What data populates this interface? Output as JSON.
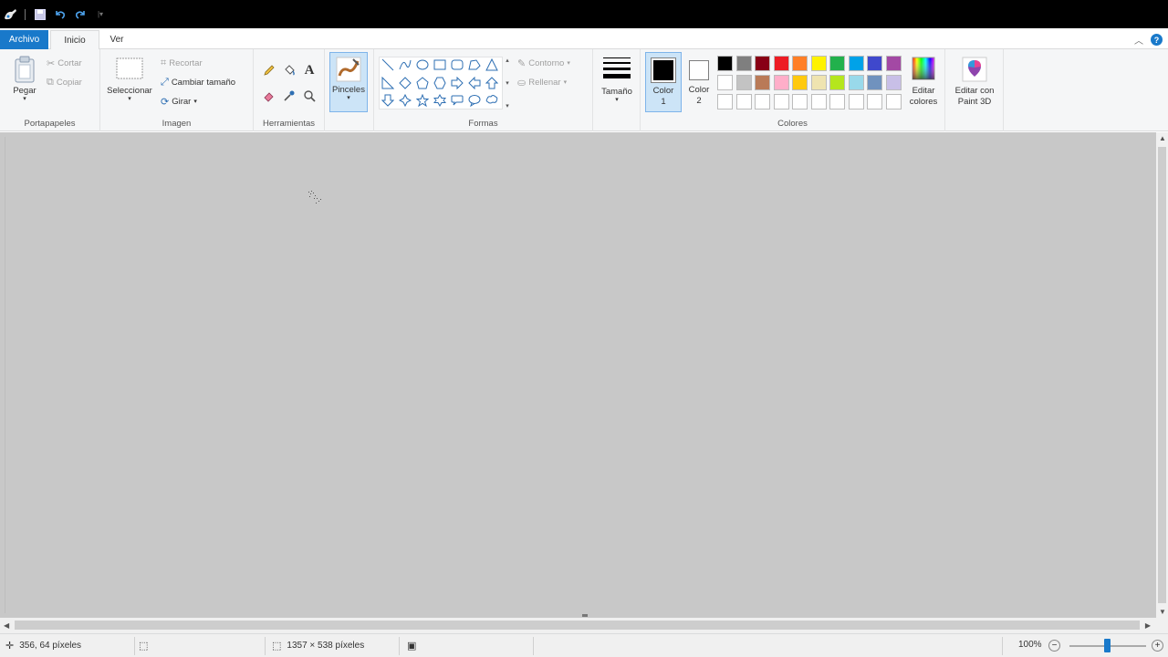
{
  "quick_access": {
    "icons": [
      "paint-app-icon",
      "save-icon",
      "undo-icon",
      "redo-icon",
      "customize-arrow-icon"
    ]
  },
  "tabs": {
    "file": "Archivo",
    "home": "Inicio",
    "view": "Ver"
  },
  "ribbon": {
    "clipboard": {
      "label": "Portapapeles",
      "paste": "Pegar",
      "cut": "Cortar",
      "copy": "Copiar"
    },
    "image": {
      "label": "Imagen",
      "select": "Seleccionar",
      "crop": "Recortar",
      "resize": "Cambiar tamaño",
      "rotate": "Girar"
    },
    "tools": {
      "label": "Herramientas"
    },
    "brushes": {
      "label": "Pinceles"
    },
    "shapes": {
      "label": "Formas",
      "outline": "Contorno",
      "fill": "Rellenar"
    },
    "size": {
      "label": "Tamaño"
    },
    "colors": {
      "label": "Colores",
      "color1_line1": "Color",
      "color1_line2": "1",
      "color2_line1": "Color",
      "color2_line2": "2",
      "edit_colors_line1": "Editar",
      "edit_colors_line2": "colores",
      "color1_value": "#000000",
      "color2_value": "#ffffff",
      "palette_row1": [
        "#000000",
        "#7f7f7f",
        "#880015",
        "#ed1c24",
        "#ff7f27",
        "#fff200",
        "#22b14c",
        "#00a2e8",
        "#3f48cc",
        "#a349a4"
      ],
      "palette_row2": [
        "#ffffff",
        "#c3c3c3",
        "#b97a57",
        "#ffaec9",
        "#ffc90e",
        "#efe4b0",
        "#b5e61d",
        "#99d9ea",
        "#7092be",
        "#c8bfe7"
      ],
      "palette_row3": [
        "#ffffff",
        "#ffffff",
        "#ffffff",
        "#ffffff",
        "#ffffff",
        "#ffffff",
        "#ffffff",
        "#ffffff",
        "#ffffff",
        "#ffffff"
      ]
    },
    "paint3d": {
      "line1": "Editar con",
      "line2": "Paint 3D"
    }
  },
  "status": {
    "cursor_position": "356, 64 píxeles",
    "canvas_size": "1357 × 538 píxeles",
    "zoom": "100%",
    "zoom_fraction": 0.5
  }
}
